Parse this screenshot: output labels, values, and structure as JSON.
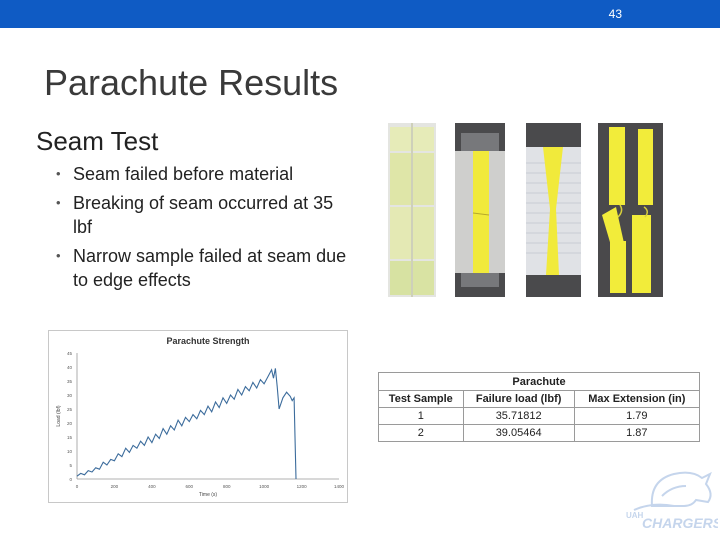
{
  "slide": {
    "page_number": "43",
    "title": "Parachute Results",
    "subtitle": "Seam Test"
  },
  "bullets": [
    "Seam failed before material",
    "Breaking of seam occurred at 35 lbf",
    "Narrow sample failed at seam due to edge effects"
  ],
  "colors": {
    "header_bar": "#0f5bc4",
    "sample_fabric": "#f2ec3a",
    "line": "#3c6c9c"
  },
  "table": {
    "caption": "Parachute",
    "headers": [
      "Test Sample",
      "Failure load (lbf)",
      "Max Extension (in)"
    ],
    "rows": [
      [
        "1",
        "35.71812",
        "1.79"
      ],
      [
        "2",
        "39.05464",
        "1.87"
      ]
    ]
  },
  "logo": {
    "text": "CHARGERS",
    "prefix": "UAH"
  },
  "chart_data": {
    "type": "line",
    "title": "Parachute Strength",
    "xlabel": "Time (s)",
    "ylabel": "Load (lbf)",
    "xlim": [
      0,
      1400
    ],
    "ylim": [
      0,
      45
    ],
    "x_ticks": [
      "0",
      "200",
      "400",
      "600",
      "800",
      "1000",
      "1200",
      "1400"
    ],
    "y_ticks": [
      "0",
      "5",
      "10",
      "15",
      "20",
      "25",
      "30",
      "35",
      "40",
      "45"
    ],
    "series": [
      {
        "x": [
          0,
          20,
          40,
          60,
          80,
          100,
          120,
          140,
          160,
          180,
          200,
          220,
          240,
          260,
          280,
          300,
          320,
          340,
          360,
          380,
          400,
          420,
          440,
          460,
          480,
          500,
          520,
          540,
          560,
          580,
          600,
          620,
          640,
          660,
          680,
          700,
          720,
          740,
          760,
          780,
          800,
          820,
          840,
          860,
          880,
          900,
          920,
          940,
          960,
          980,
          1000,
          1020,
          1040,
          1050,
          1060,
          1070,
          1080,
          1100,
          1120,
          1140,
          1150,
          1160,
          1165,
          1170
        ],
        "y": [
          1,
          2,
          1.5,
          3,
          2.5,
          4,
          3.5,
          6,
          5,
          7,
          6.5,
          9,
          8,
          11,
          9.5,
          12,
          11,
          13.5,
          12,
          15,
          13,
          16,
          14.5,
          18,
          16,
          19,
          17.5,
          21,
          19,
          22,
          20.5,
          23,
          21.5,
          24.5,
          23,
          26,
          24,
          27.5,
          25.5,
          29,
          27,
          30,
          28.5,
          32,
          30,
          33,
          31.5,
          34.5,
          32.5,
          35.5,
          34,
          36.5,
          39,
          36,
          39.5,
          33,
          25,
          29,
          31,
          29.5,
          28,
          29,
          15,
          0
        ]
      }
    ]
  }
}
